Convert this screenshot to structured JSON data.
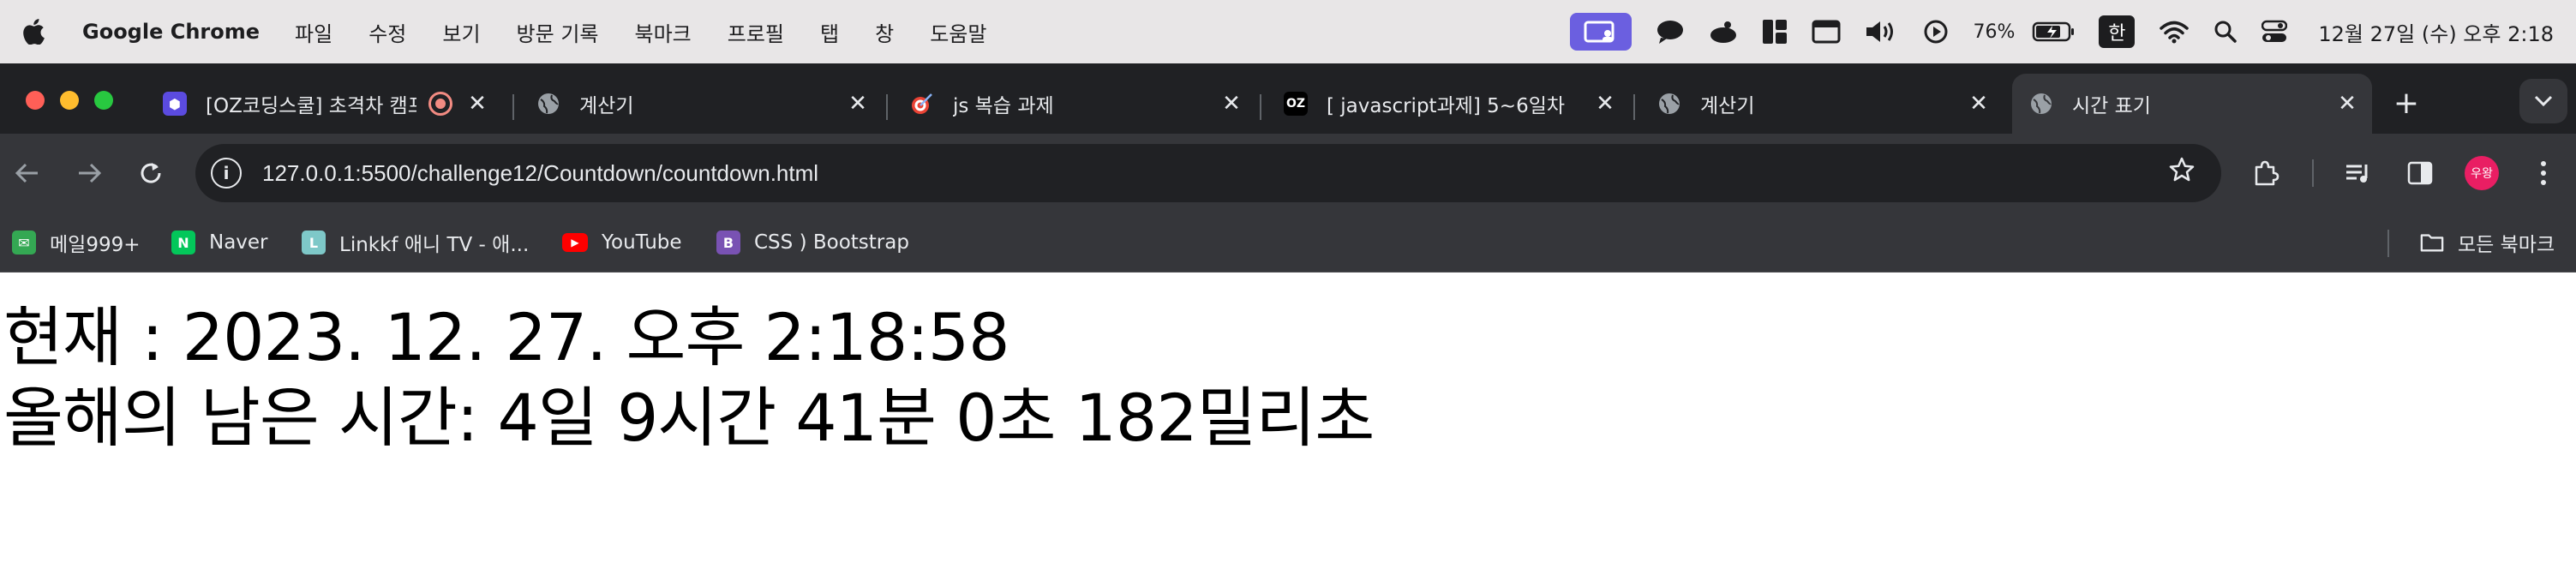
{
  "menubar": {
    "app_name": "Google Chrome",
    "items": [
      "파일",
      "수정",
      "보기",
      "방문 기록",
      "북마크",
      "프로필",
      "탭",
      "창",
      "도움말"
    ],
    "battery": "76%",
    "input_method": "한",
    "clock": "12월 27일 (수) 오후 2:18"
  },
  "tabs": [
    {
      "title": "[OZ코딩스쿨] 초격차 캠프",
      "favicon_color": "#5b4be0",
      "icon": "oz-icon"
    },
    {
      "title": "계산기",
      "icon": "globe-icon"
    },
    {
      "title": "js 복습 과제",
      "icon": "target-icon"
    },
    {
      "title": "[ javascript과제] 5~6일차",
      "icon": "oz-icon"
    },
    {
      "title": "계산기",
      "icon": "globe-icon"
    },
    {
      "title": "시간 표기",
      "icon": "globe-icon",
      "active": true
    }
  ],
  "omnibox": {
    "url": "127.0.0.1:5500/challenge12/Countdown/countdown.html"
  },
  "profile": {
    "initials": "우왕",
    "color": "#e91e63"
  },
  "bookmarks": [
    {
      "label": "메일999+",
      "color": "#34a853"
    },
    {
      "label": "Naver",
      "color": "#03c75a"
    },
    {
      "label": "Linkkf 애니 TV - 애...",
      "color": "#7ec8c8"
    },
    {
      "label": "YouTube",
      "color": "#ff0000"
    },
    {
      "label": "CSS ) Bootstrap",
      "color": "#7952b3"
    }
  ],
  "all_bookmarks": "모든 북마크",
  "page": {
    "now": "현재 : 2023. 12. 27. 오후 2:18:58",
    "remaining": "올해의 남은 시간: 4일 9시간 41분 0초 182밀리초"
  }
}
